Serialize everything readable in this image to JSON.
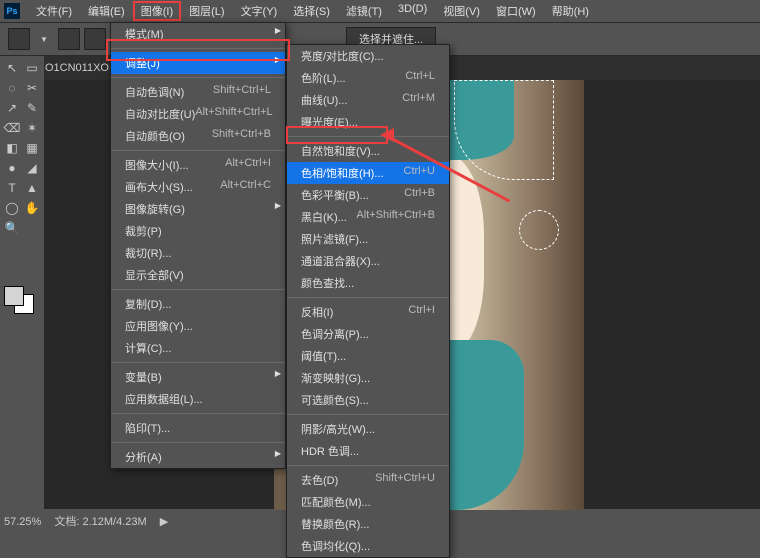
{
  "menubar": {
    "items": [
      "文件(F)",
      "编辑(E)",
      "图像(I)",
      "图层(L)",
      "文字(Y)",
      "选择(S)",
      "滤镜(T)",
      "3D(D)",
      "视图(V)",
      "窗口(W)",
      "帮助(H)"
    ],
    "highlighted_index": 2
  },
  "optionsbar": {
    "select_and_mask": "选择并遮住..."
  },
  "tab": {
    "label": "O1CN011XO"
  },
  "dropdown_image": {
    "groups": [
      [
        {
          "label": "模式(M)",
          "sub": true
        }
      ],
      [
        {
          "label": "调整(J)",
          "sub": true,
          "hov": true
        }
      ],
      [
        {
          "label": "自动色调(N)",
          "sc": "Shift+Ctrl+L"
        },
        {
          "label": "自动对比度(U)",
          "sc": "Alt+Shift+Ctrl+L"
        },
        {
          "label": "自动颜色(O)",
          "sc": "Shift+Ctrl+B"
        }
      ],
      [
        {
          "label": "图像大小(I)...",
          "sc": "Alt+Ctrl+I"
        },
        {
          "label": "画布大小(S)...",
          "sc": "Alt+Ctrl+C"
        },
        {
          "label": "图像旋转(G)",
          "sub": true
        },
        {
          "label": "裁剪(P)"
        },
        {
          "label": "裁切(R)..."
        },
        {
          "label": "显示全部(V)"
        }
      ],
      [
        {
          "label": "复制(D)..."
        },
        {
          "label": "应用图像(Y)..."
        },
        {
          "label": "计算(C)..."
        }
      ],
      [
        {
          "label": "变量(B)",
          "sub": true
        },
        {
          "label": "应用数据组(L)..."
        }
      ],
      [
        {
          "label": "陷印(T)..."
        }
      ],
      [
        {
          "label": "分析(A)",
          "sub": true
        }
      ]
    ]
  },
  "dropdown_adjust": {
    "groups": [
      [
        {
          "label": "亮度/对比度(C)..."
        },
        {
          "label": "色阶(L)...",
          "sc": "Ctrl+L"
        },
        {
          "label": "曲线(U)...",
          "sc": "Ctrl+M"
        },
        {
          "label": "曝光度(E)..."
        }
      ],
      [
        {
          "label": "自然饱和度(V)..."
        },
        {
          "label": "色相/饱和度(H)...",
          "sc": "Ctrl+U",
          "hov": true
        },
        {
          "label": "色彩平衡(B)...",
          "sc": "Ctrl+B"
        },
        {
          "label": "黑白(K)...",
          "sc": "Alt+Shift+Ctrl+B"
        },
        {
          "label": "照片滤镜(F)..."
        },
        {
          "label": "通道混合器(X)..."
        },
        {
          "label": "颜色查找..."
        }
      ],
      [
        {
          "label": "反相(I)",
          "sc": "Ctrl+I"
        },
        {
          "label": "色调分离(P)..."
        },
        {
          "label": "阈值(T)..."
        },
        {
          "label": "渐变映射(G)..."
        },
        {
          "label": "可选颜色(S)..."
        }
      ],
      [
        {
          "label": "阴影/高光(W)..."
        },
        {
          "label": "HDR 色调..."
        }
      ],
      [
        {
          "label": "去色(D)",
          "sc": "Shift+Ctrl+U"
        },
        {
          "label": "匹配颜色(M)..."
        },
        {
          "label": "替换颜色(R)..."
        },
        {
          "label": "色调均化(Q)..."
        }
      ]
    ]
  },
  "status": {
    "zoom": "57.25%",
    "docinfo": "文档: 2.12M/4.23M"
  },
  "tools": [
    "↖",
    "▭",
    "◌",
    "✂",
    "↗",
    "✎",
    "⌫",
    "✶",
    "◧",
    "▦",
    "●",
    "◢",
    "T",
    "▲",
    "◯",
    "✋",
    "🔍"
  ]
}
